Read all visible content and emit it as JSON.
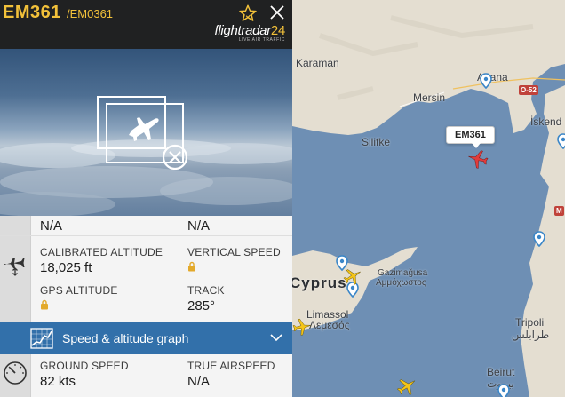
{
  "flight": {
    "callsign": "EM361",
    "sub_code": "/EM0361",
    "map_tag": "EM361"
  },
  "brand": {
    "name_main": "flightradar",
    "name_num": "24",
    "tagline": "LIVE AIR TRAFFIC"
  },
  "icons": {
    "favorite": "star-icon",
    "close": "close-icon",
    "no_photo": "no-photo-icon",
    "altitude": "altitude-plane-icon",
    "graph": "graph-icon",
    "expand": "chevron-down-icon",
    "speed": "speedometer-icon",
    "lock": "lock-icon"
  },
  "top_row": {
    "left_value": "N/A",
    "right_value": "N/A"
  },
  "altitude_section": {
    "calibrated_altitude_label": "CALIBRATED ALTITUDE",
    "calibrated_altitude_value": "18,025 ft",
    "vertical_speed_label": "VERTICAL SPEED",
    "gps_altitude_label": "GPS ALTITUDE",
    "track_label": "TRACK",
    "track_value": "285°"
  },
  "graph_bar": {
    "label": "Speed & altitude graph"
  },
  "speed_section": {
    "ground_speed_label": "GROUND SPEED",
    "ground_speed_value": "82 kts",
    "true_airspeed_label": "TRUE AIRSPEED",
    "true_airspeed_value": "N/A"
  },
  "map_labels": {
    "karaman": "Karaman",
    "adana": "Adana",
    "mersin": "Mersin",
    "silifke": "Silifke",
    "iskenderun": "İskend",
    "cyprus": "Cyprus",
    "gazimagusa": "Gazimağusa",
    "ammochostos": "Αμμόχωστος",
    "limassol": "Limassol",
    "lemesos": "Λεμεσός",
    "tripoli": "Tripoli",
    "tripoli_ar": "طرابلس",
    "beirut": "Beirut",
    "beirut_ar": "بيروت",
    "road_o52": "O-52",
    "road_m": "M"
  },
  "colors": {
    "accent": "#f2c13a",
    "header_bg": "#202122",
    "graph_bar": "#3270aa",
    "sea": "#6e8fb4",
    "land": "#e4ded1",
    "selected_plane": "#e23b3b",
    "other_plane": "#f5c518"
  }
}
